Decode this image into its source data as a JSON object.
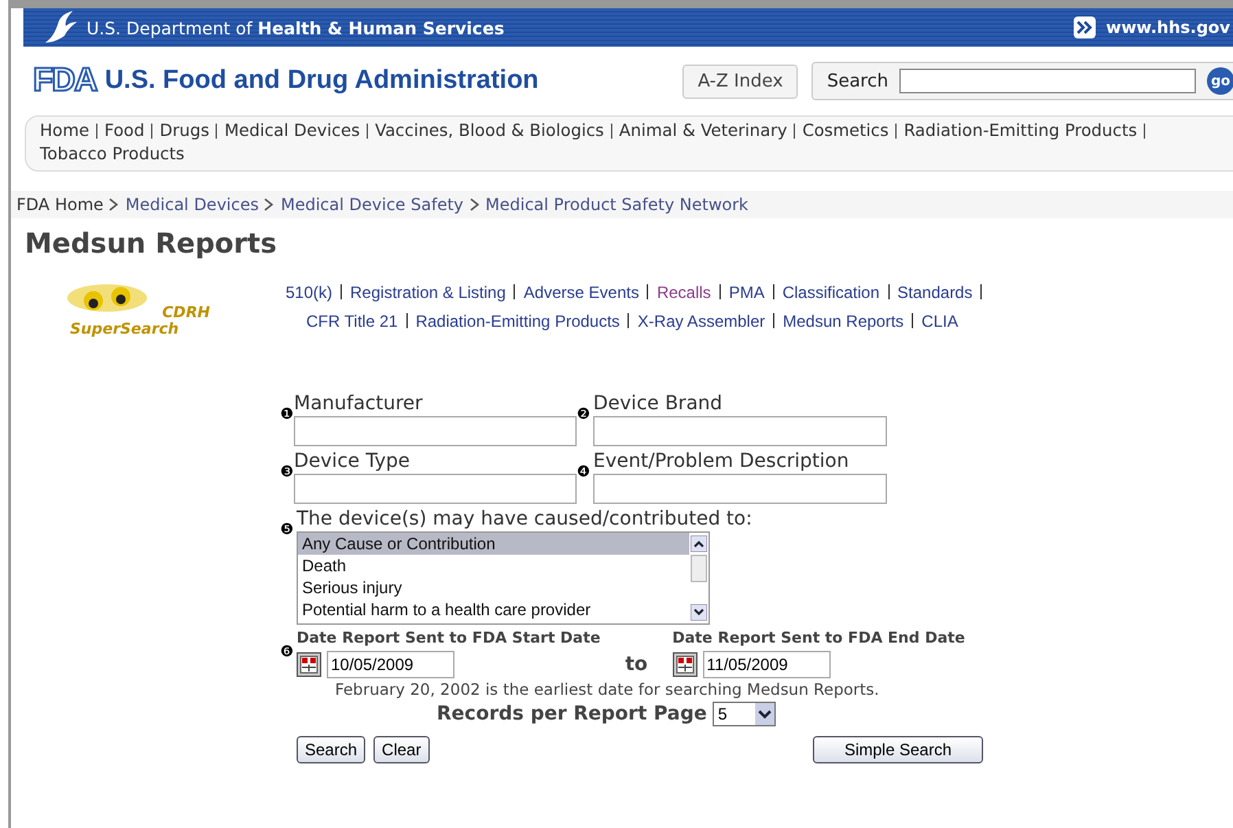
{
  "hhs_bar": {
    "department": "U.S. Department of",
    "department_bold": "Health & Human Services",
    "link": "www.hhs.gov"
  },
  "header": {
    "logo": "FDA",
    "title": "U.S. Food and Drug Administration",
    "az_index": "A-Z Index",
    "search_label": "Search",
    "go": "go"
  },
  "nav": [
    "Home",
    "Food",
    "Drugs",
    "Medical Devices",
    "Vaccines, Blood & Biologics",
    "Animal & Veterinary",
    "Cosmetics",
    "Radiation-Emitting Products",
    "Tobacco Products"
  ],
  "breadcrumb": [
    "FDA Home",
    "Medical Devices",
    "Medical Device Safety",
    "Medical Product Safety Network"
  ],
  "page_title": "Medsun Reports",
  "supersearch": {
    "logo_top": "CDRH",
    "logo_bottom": "SuperSearch",
    "links": [
      {
        "label": "510(k)",
        "visited": false
      },
      {
        "label": "Registration & Listing",
        "visited": false
      },
      {
        "label": "Adverse Events",
        "visited": false
      },
      {
        "label": "Recalls",
        "visited": true
      },
      {
        "label": "PMA",
        "visited": false
      },
      {
        "label": "Classification",
        "visited": false
      },
      {
        "label": "Standards",
        "visited": false
      },
      {
        "label": "CFR Title 21",
        "visited": false
      },
      {
        "label": "Radiation-Emitting Products",
        "visited": false
      },
      {
        "label": "X-Ray Assembler",
        "visited": false
      },
      {
        "label": "Medsun Reports",
        "visited": false
      },
      {
        "label": "CLIA",
        "visited": false
      }
    ]
  },
  "fields": [
    {
      "marker": "❶",
      "label": "Manufacturer"
    },
    {
      "marker": "❷",
      "label": "Device Brand"
    },
    {
      "marker": "❸",
      "label": "Device Type"
    },
    {
      "marker": "❹",
      "label": "Event/Problem Description"
    }
  ],
  "cause": {
    "marker": "❺",
    "label": "The device(s) may have caused/contributed to:",
    "options": [
      {
        "label": "Any Cause or Contribution",
        "selected": true
      },
      {
        "label": "Death",
        "selected": false
      },
      {
        "label": "Serious injury",
        "selected": false
      },
      {
        "label": "Potential harm to a health care provider",
        "selected": false
      }
    ]
  },
  "dates": {
    "marker": "❻",
    "start_label": "Date Report Sent to FDA Start Date",
    "start": "10/05/2009",
    "to": "to",
    "end_label": "Date Report Sent to FDA End Date",
    "end": "11/05/2009",
    "note": "February 20, 2002 is the earliest date for searching Medsun Reports."
  },
  "records": {
    "label": "Records per Report Page",
    "value": "5"
  },
  "buttons": {
    "search": "Search",
    "clear": "Clear",
    "simple": "Simple Search"
  }
}
